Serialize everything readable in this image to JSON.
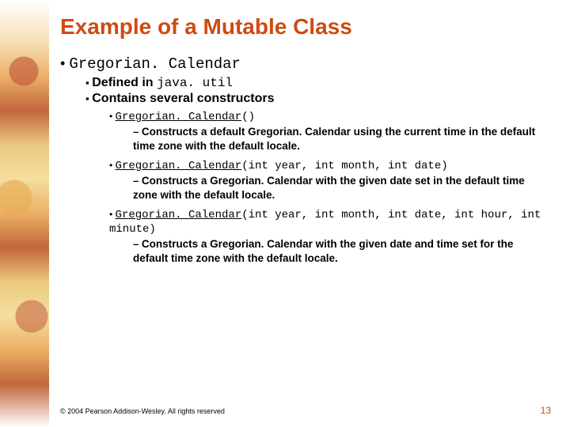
{
  "title": "Example of a Mutable Class",
  "bullet1": "Gregorian. Calendar",
  "sub1_prefix": "Defined in ",
  "sub1_mono": "java. util",
  "sub2": "Contains several constructors",
  "ctor1_link": "Gregorian. Calendar",
  "ctor1_rest": "()",
  "ctor1_desc": "Constructs a default Gregorian. Calendar using the current time in the default time zone with the default locale.",
  "ctor2_link": "Gregorian. Calendar",
  "ctor2_rest": "(int year, int month, int date)",
  "ctor2_desc": "Constructs a Gregorian. Calendar with the given date set in the default time zone with the default locale.",
  "ctor3_link": "Gregorian. Calendar",
  "ctor3_rest": "(int year, int month, int date, int hour, int minute)",
  "ctor3_desc": " Constructs a Gregorian. Calendar with the given date and time set for the default time zone with the default locale.",
  "copyright": "© 2004 Pearson Addison-Wesley. All rights reserved",
  "page": "13"
}
